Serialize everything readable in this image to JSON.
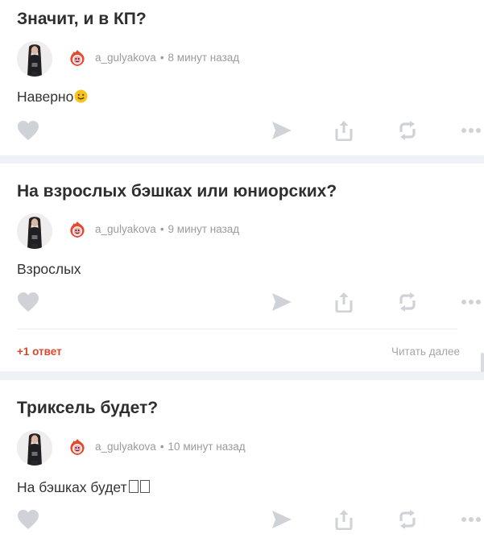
{
  "colors": {
    "accent": "#d9472b",
    "divider": "#eef1f6",
    "icon": "#cfd2d6",
    "meta": "#9b9b9b"
  },
  "posts": [
    {
      "question": "Значит, и в КП?",
      "author": "a_gulyakova",
      "time": "8 минут назад",
      "answer": "Наверно",
      "answer_emoji": "smiling-face-emoji"
    },
    {
      "question": "На взрослых бэшках или юниорских?",
      "author": "a_gulyakova",
      "time": "9 минут назад",
      "answer": "Взрослых",
      "replies": "+1 ответ",
      "read_more": "Читать далее"
    },
    {
      "question": "Триксель будет?",
      "author": "a_gulyakova",
      "time": "10 минут назад",
      "answer": "На бэшках будет",
      "answer_glyphs": "missing-glyph-boxes"
    }
  ],
  "icons": [
    "heart-icon",
    "send-icon",
    "upload-icon",
    "repost-icon",
    "more-icon",
    "flame-badge-icon"
  ]
}
